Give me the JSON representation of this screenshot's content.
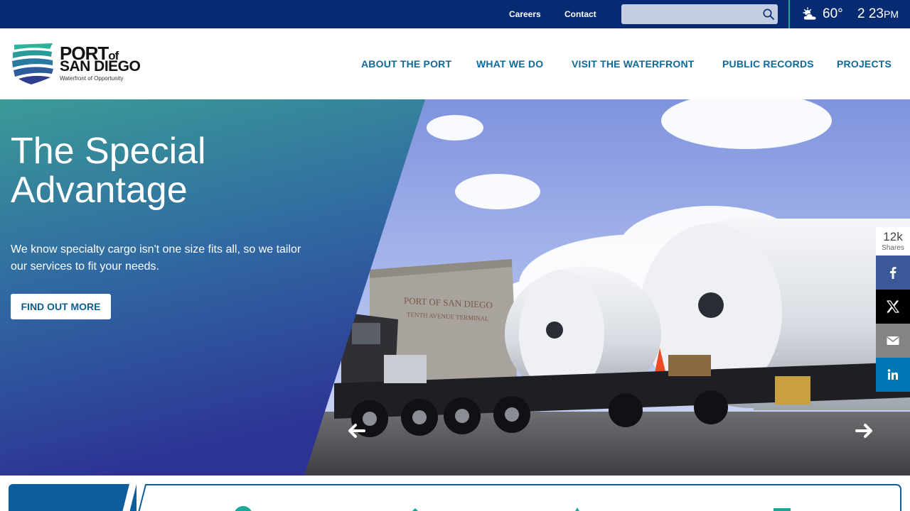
{
  "utility": {
    "careers": "Careers",
    "contact": "Contact",
    "search_placeholder": "",
    "temperature": "60°",
    "time": "2 23",
    "ampm": "PM"
  },
  "logo": {
    "line1": "PORT",
    "line1_small": "of",
    "line2": "SAN DIEGO",
    "tagline": "Waterfront of Opportunity"
  },
  "nav": {
    "items": [
      "ABOUT THE PORT",
      "WHAT WE DO",
      "VISIT THE WATERFRONT",
      "PUBLIC RECORDS",
      "PROJECTS"
    ]
  },
  "hero": {
    "title": "The Special Advantage",
    "body": "We know specialty cargo isn't one size fits all, so we tailor our services to fit your needs.",
    "cta": "FIND OUT MORE",
    "photo_signage": [
      "PORT OF SAN DIEGO",
      "TENTH AVENUE TERMINAL"
    ]
  },
  "share": {
    "count": "12k",
    "label": "Shares",
    "buttons": [
      "facebook-icon",
      "x-icon",
      "email-icon",
      "linkedin-icon"
    ]
  },
  "colors": {
    "topbar": "#062b72",
    "nav_text": "#0c6a9c",
    "hero_teal": "#3a9a97",
    "hero_indigo": "#2d3394",
    "facebook": "#3b5998",
    "linkedin": "#0077b5",
    "accent_teal": "#2aa59a"
  }
}
